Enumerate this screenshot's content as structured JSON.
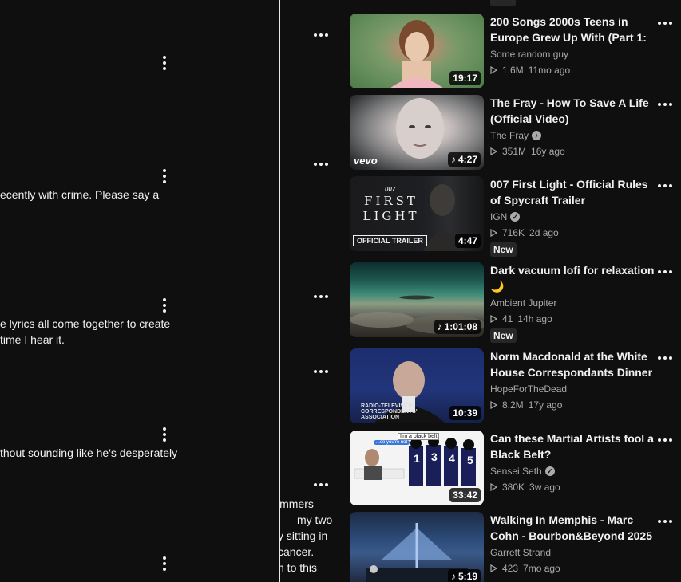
{
  "comments": {
    "lines": [
      "ecently with crime. Please say a",
      "e lyrics all come together to create",
      "time I hear it.",
      "thout sounding like he's desperately"
    ],
    "middle_lines": [
      "immers",
      "my two",
      "y sitting in",
      "cancer.",
      "h to this"
    ]
  },
  "recommendations": [
    {
      "title": "200 Songs 2000s Teens in Europe Grew Up With (Part 1: ...",
      "channel": "Some random guy",
      "verified": false,
      "views": "1.6M",
      "age": "11mo ago",
      "duration": "19:17",
      "music": false,
      "is_new": false
    },
    {
      "title": "The Fray - How To Save A Life (Official Video)",
      "channel": "The Fray",
      "verified": true,
      "views": "351M",
      "age": "16y ago",
      "duration": "4:27",
      "music": true,
      "is_new": false,
      "thumb_text": "vevo"
    },
    {
      "title": "007 First Light - Official Rules of Spycraft Trailer",
      "channel": "IGN",
      "verified": true,
      "views": "716K",
      "age": "2d ago",
      "duration": "4:47",
      "music": false,
      "is_new": true,
      "thumb_text": "FIRST LIGHT",
      "thumb_small": "007",
      "thumb_badge": "OFFICIAL TRAILER"
    },
    {
      "title": "Dark vacuum lofi for relaxation 🌙",
      "channel": "Ambient Jupiter",
      "verified": false,
      "views": "41",
      "age": "14h ago",
      "duration": "1:01:08",
      "music": true,
      "is_new": true
    },
    {
      "title": "Norm Macdonald at the White House Correspondants Dinner ...",
      "channel": "HopeForTheDead",
      "verified": false,
      "views": "8.2M",
      "age": "17y ago",
      "duration": "10:39",
      "music": false,
      "is_new": false,
      "thumb_text": "RADIO-TELEVISION CORRESPONDENTS' ASSOCIATION"
    },
    {
      "title": "Can these Martial Artists fool a Black Belt?",
      "channel": "Sensei Seth",
      "verified": true,
      "views": "380K",
      "age": "3w ago",
      "duration": "33:42",
      "music": false,
      "is_new": false,
      "thumb_text": "I'm a black belt",
      "thumb_text2": "...so you're not"
    },
    {
      "title": "Walking In Memphis - Marc Cohn - Bourbon&Beyond 2025",
      "channel": "Garrett Strand",
      "verified": false,
      "views": "423",
      "age": "7mo ago",
      "duration": "5:19",
      "music": true,
      "is_new": false
    }
  ],
  "new_label": "New",
  "colors": {
    "background": "#0f0f0f",
    "text": "#f1f1f1",
    "secondary": "#aaaaaa",
    "badge": "#272727"
  }
}
